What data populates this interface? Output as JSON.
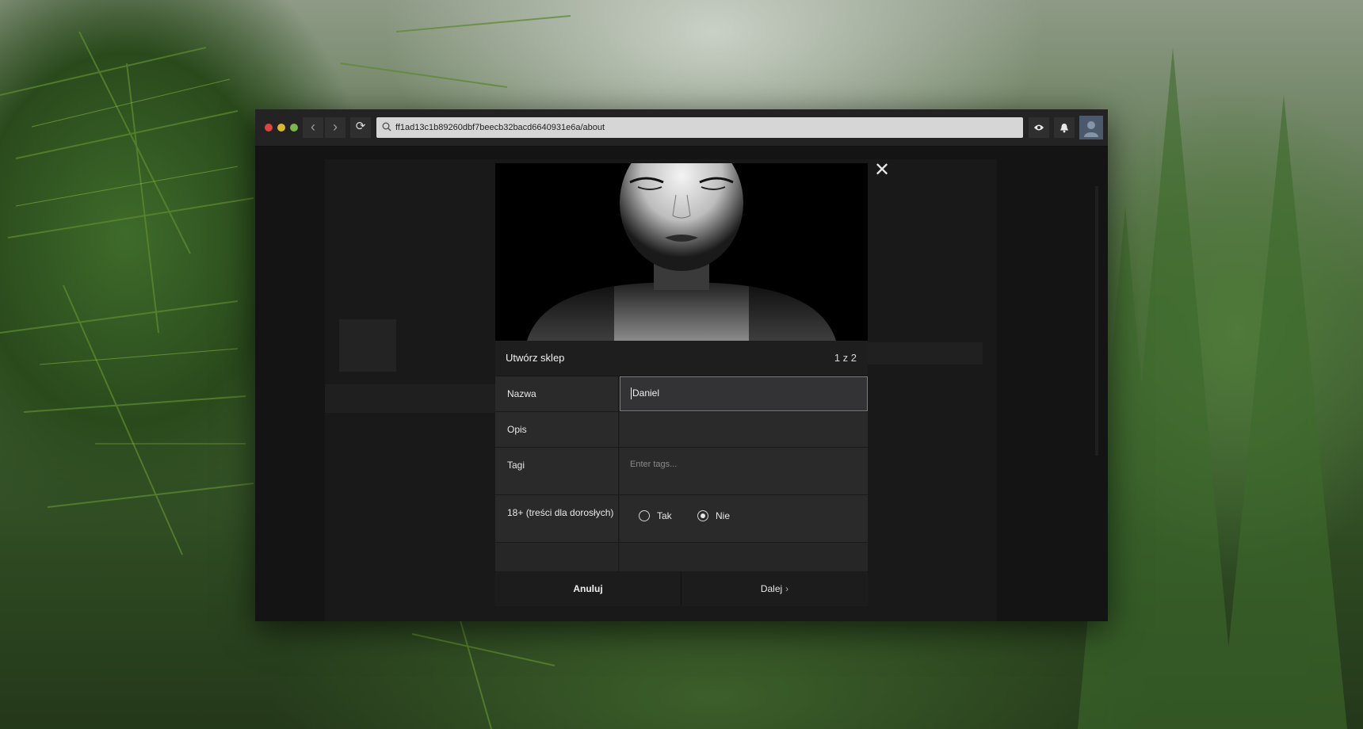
{
  "browser": {
    "url": "ff1ad13c1b89260dbf7beecb32bacd6640931e6a/about"
  },
  "modal": {
    "title": "Utwórz sklep",
    "step": "1 z 2",
    "fields": {
      "name_label": "Nazwa",
      "name_value": "Daniel",
      "description_label": "Opis",
      "tags_label": "Tagi",
      "tags_placeholder": "Enter tags...",
      "adult_label": "18+ (treści dla dorosłych)",
      "adult_yes": "Tak",
      "adult_no": "Nie",
      "adult_selected": "Nie"
    },
    "buttons": {
      "cancel": "Anuluj",
      "next": "Dalej"
    }
  },
  "colors": {
    "window_bg": "#1b1b1c",
    "modal_bg": "#222223",
    "urlbar_bg": "#d6d6d6",
    "close_red": "#e0443e",
    "minimize_yellow": "#d9b82a",
    "maximize_green": "#78b84a"
  },
  "icons": [
    "search-icon",
    "eye-icon",
    "bell-icon",
    "back-arrow-icon",
    "forward-arrow-icon",
    "reload-icon",
    "close-icon",
    "chevron-right-icon"
  ]
}
